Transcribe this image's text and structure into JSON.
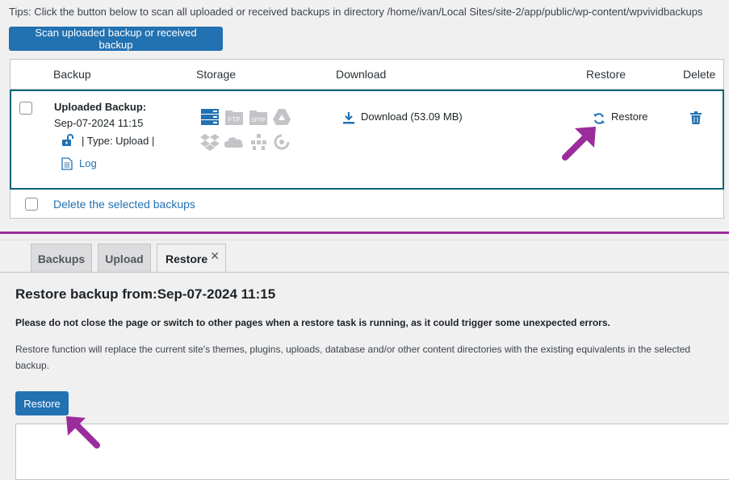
{
  "tips": "Tips: Click the button below to scan all uploaded or received backups in directory /home/ivan/Local Sites/site-2/app/public/wp-content/wpvividbackups",
  "scan_button": "Scan uploaded backup or received backup",
  "table": {
    "headers": {
      "backup": "Backup",
      "storage": "Storage",
      "download": "Download",
      "restore": "Restore",
      "delete": "Delete"
    },
    "row": {
      "title": "Uploaded Backup:",
      "date": "Sep-07-2024 11:15",
      "type": "| Type: Upload |",
      "log": "Log",
      "download": "Download (53.09 MB)",
      "restore": "Restore",
      "storage_icons": [
        "local-storage-icon",
        "ftp-icon",
        "sftp-icon",
        "google-drive-icon",
        "dropbox-icon",
        "onedrive-icon",
        "s3-icon",
        "wasabi-icon"
      ],
      "storage_labels": {
        "ftp": "FTP",
        "sftp": "SFTP"
      }
    },
    "footer": {
      "delete_selected": "Delete the selected backups"
    }
  },
  "tabs": [
    {
      "label": "Backups"
    },
    {
      "label": "Upload"
    },
    {
      "label": "Restore"
    }
  ],
  "restore": {
    "title": "Restore backup from:Sep-07-2024 11:15",
    "warning": "Please do not close the page or switch to other pages when a restore task is running, as it could trigger some unexpected errors.",
    "description": "Restore function will replace the current site's themes, plugins, uploads, database and/or other content directories with the existing equivalents in the selected backup.",
    "button": "Restore"
  },
  "colors": {
    "primary": "#2271b1",
    "row_highlight": "#0d6577",
    "annotation_arrow": "#9b2c9b",
    "storage_active": "#2271b1",
    "storage_inactive": "#c3c4c7"
  }
}
